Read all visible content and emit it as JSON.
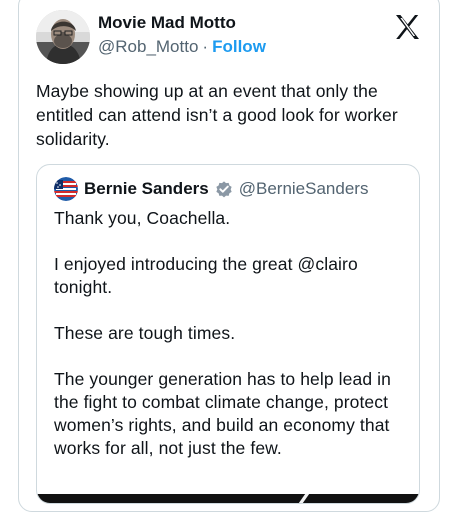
{
  "tweet": {
    "author_name": "Movie Mad Motto",
    "handle": "@Rob_Motto",
    "separator": "·",
    "follow_label": "Follow",
    "text": "Maybe showing up at an event that only the entitled can attend isn’t a good look for worker solidarity."
  },
  "brand": {
    "icon": "x-logo-icon"
  },
  "quoted_tweet": {
    "author_name": "Bernie Sanders",
    "handle": "@BernieSanders",
    "verified_icon": "verified-badge-icon",
    "paragraphs": [
      "Thank you, Coachella.",
      "I enjoyed introducing the great @clairo tonight.",
      "These are tough times.",
      "The younger generation has to help lead in the fight to combat climate change, protect women’s rights, and build an economy that works for all, not just the few."
    ]
  },
  "colors": {
    "text": "#0f1419",
    "secondary": "#536471",
    "link": "#1d9bf0",
    "border": "#cfd9de",
    "verified": "#8b98a5"
  }
}
